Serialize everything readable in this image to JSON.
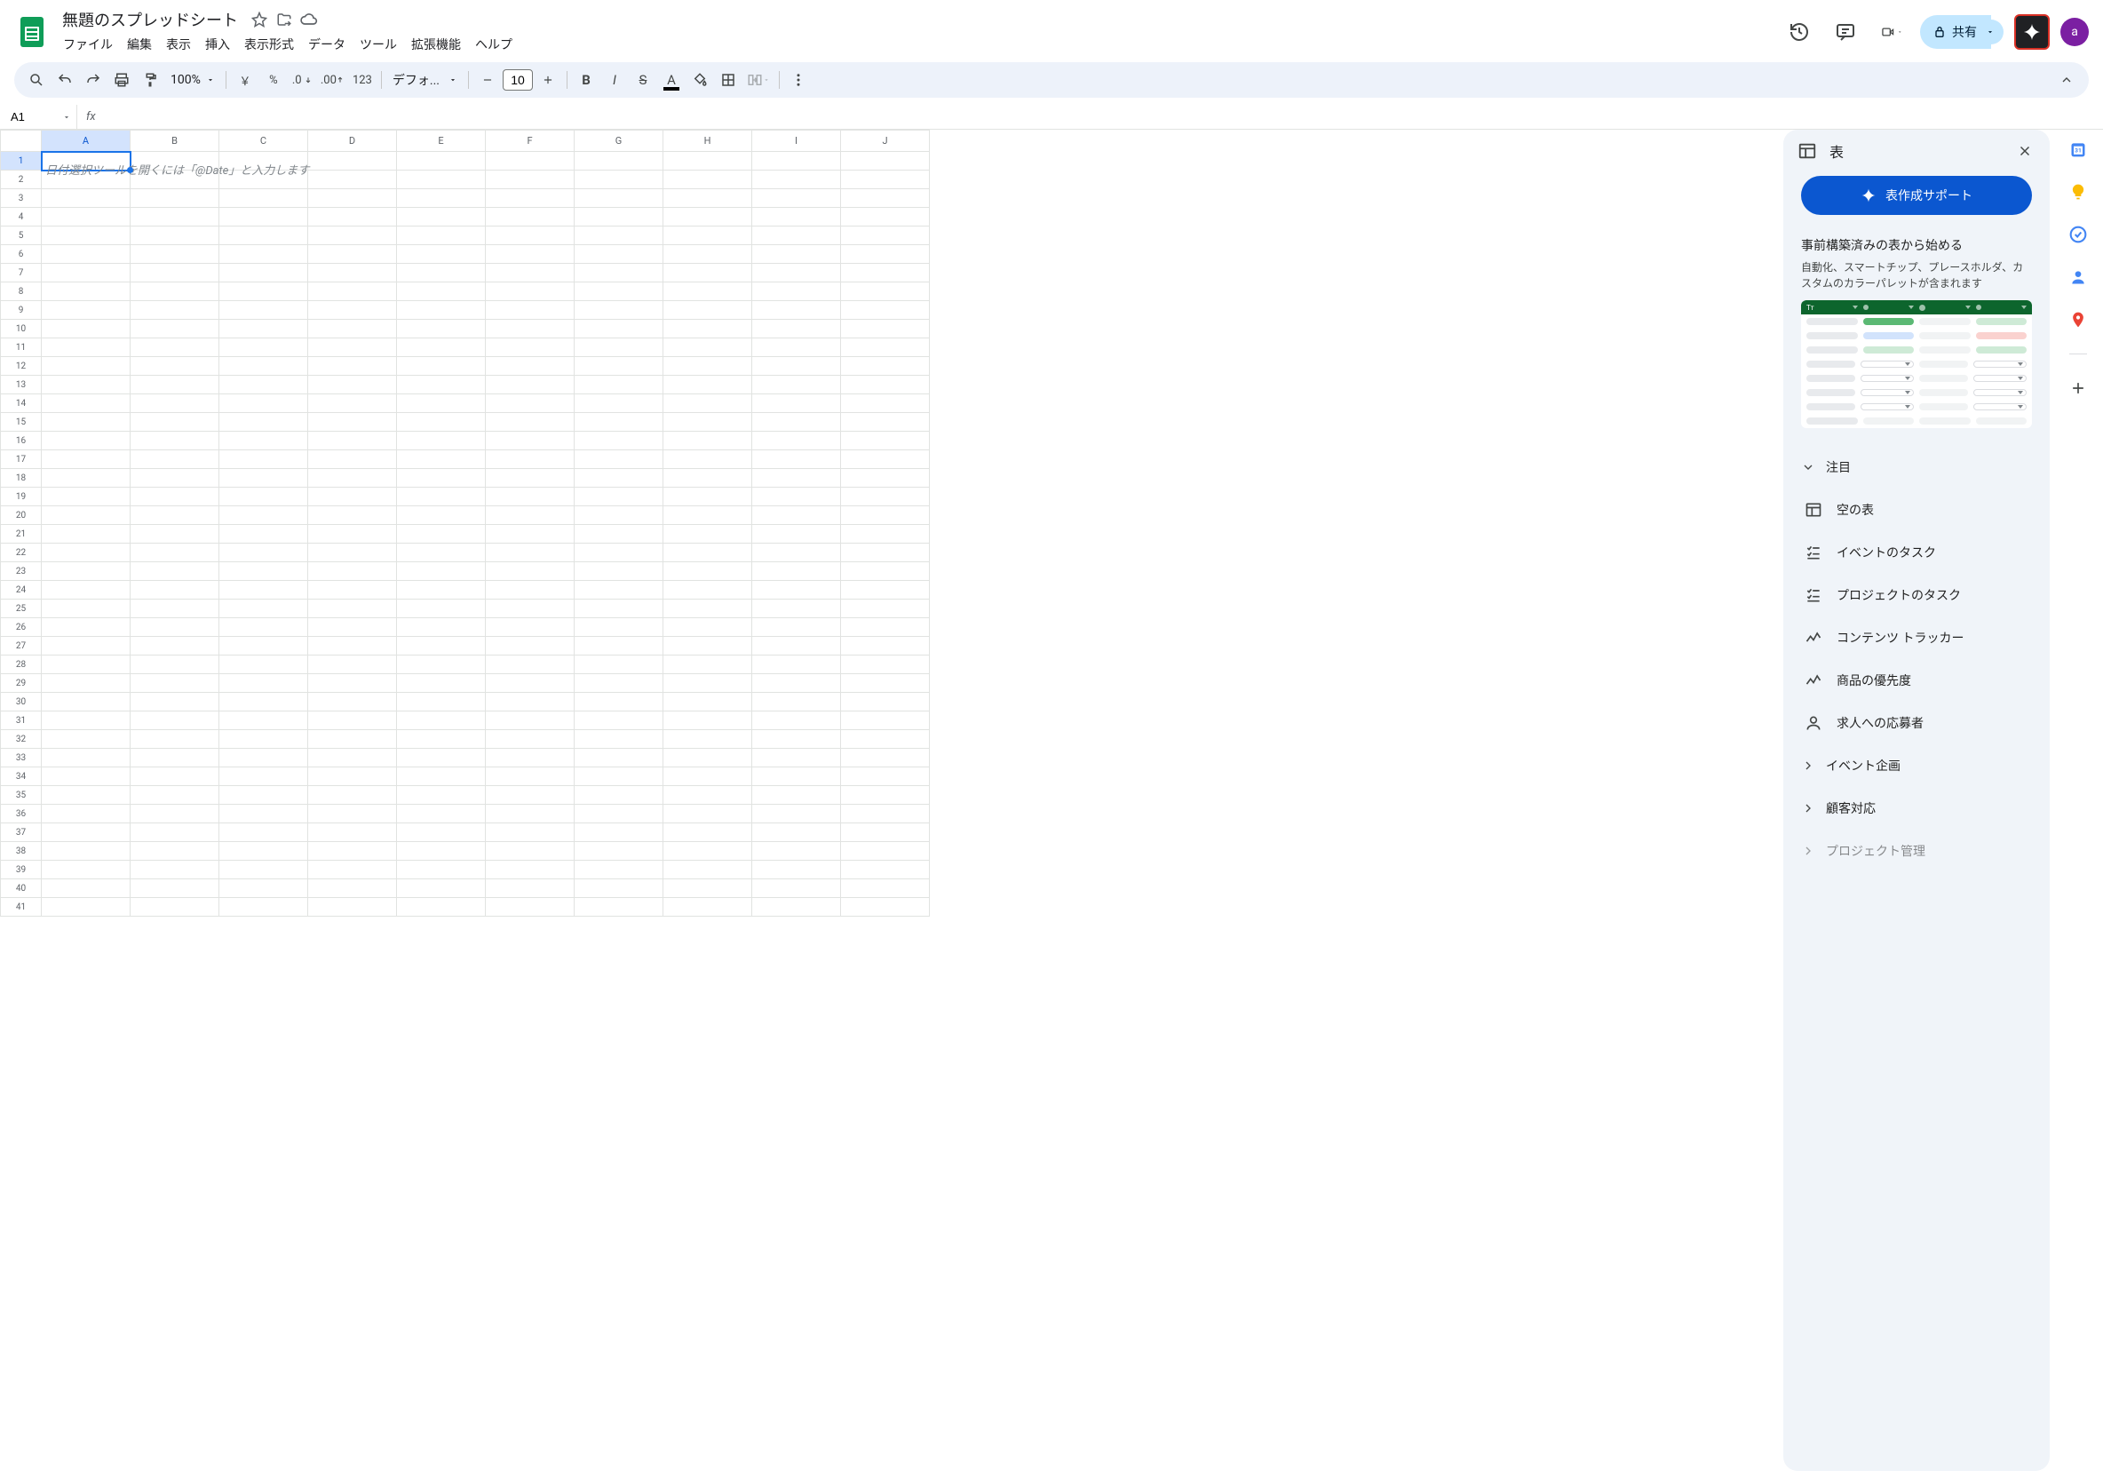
{
  "header": {
    "doc_title": "無題のスプレッドシート",
    "avatar_letter": "a",
    "share_label": "共有"
  },
  "menu": {
    "file": "ファイル",
    "edit": "編集",
    "view": "表示",
    "insert": "挿入",
    "format": "表示形式",
    "data": "データ",
    "tools": "ツール",
    "extensions": "拡張機能",
    "help": "ヘルプ"
  },
  "toolbar": {
    "zoom": "100%",
    "currency": "￥",
    "percent": "%",
    "num_format": "123",
    "font_name": "デフォ...",
    "font_size": "10"
  },
  "formula_bar": {
    "name_box": "A1",
    "fx": "fx"
  },
  "grid": {
    "columns": [
      "A",
      "B",
      "C",
      "D",
      "E",
      "F",
      "G",
      "H",
      "I",
      "J"
    ],
    "rows": 41,
    "active_cell_placeholder": "日付選択ツールを開くには「@Date」と入力します"
  },
  "panel": {
    "title": "表",
    "support_btn": "表作成サポート",
    "subtitle": "事前構築済みの表から始める",
    "description": "自動化、スマートチップ、プレースホルダ、カスタムのカラーパレットが含まれます",
    "sections": {
      "featured": "注目",
      "event_planning": "イベント企画",
      "customer": "顧客対応",
      "project_mgmt": "プロジェクト管理"
    },
    "templates": {
      "empty_table": "空の表",
      "event_tasks": "イベントのタスク",
      "project_tasks": "プロジェクトのタスク",
      "content_tracker": "コンテンツ トラッカー",
      "product_priority": "商品の優先度",
      "applicants": "求人への応募者"
    }
  },
  "rail": {
    "calendar_day": "31"
  }
}
